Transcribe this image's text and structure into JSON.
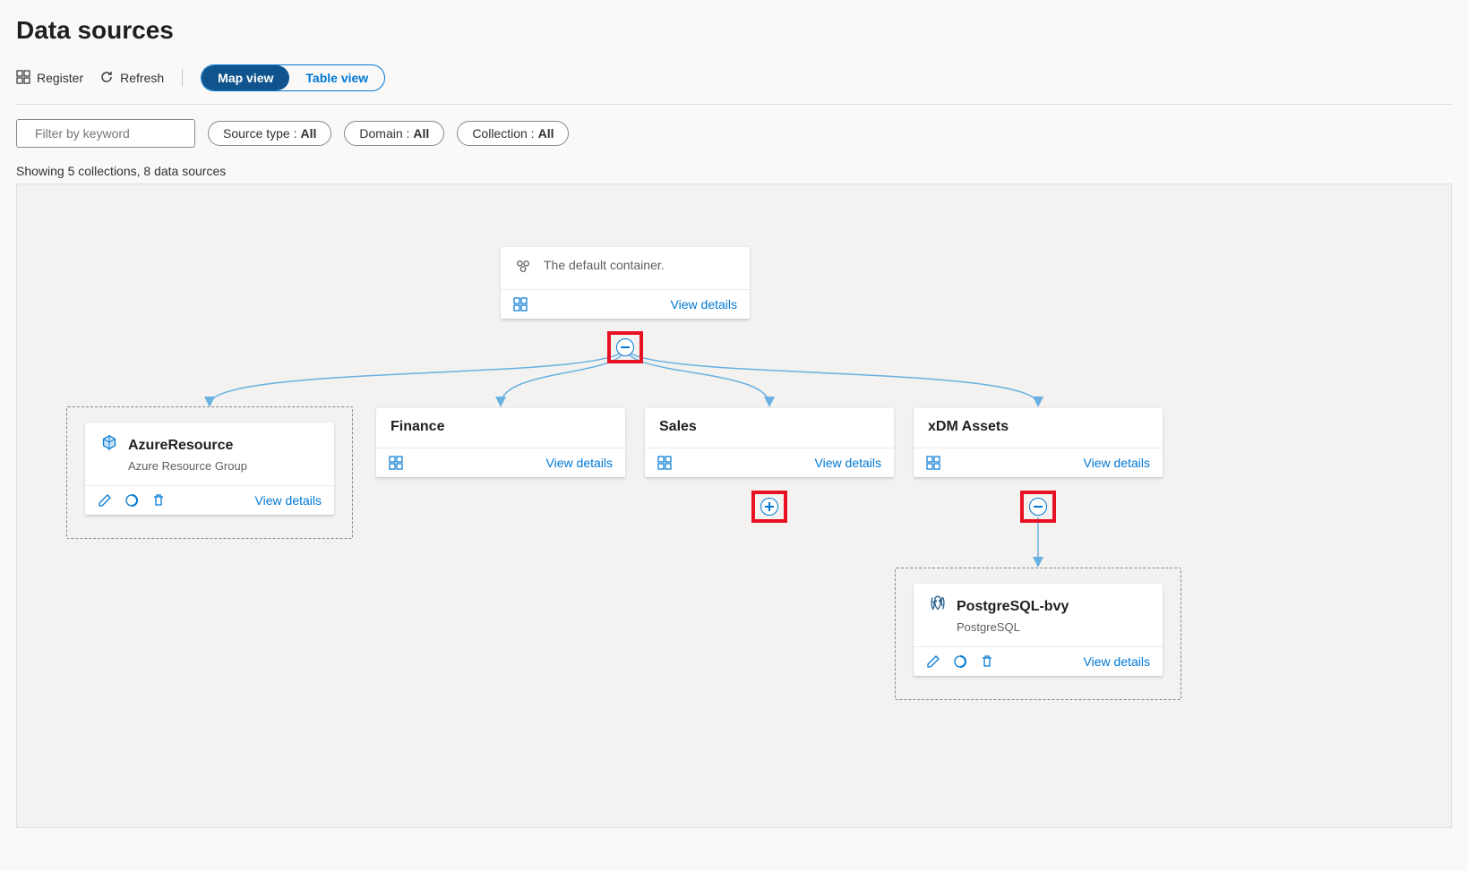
{
  "page": {
    "title": "Data sources"
  },
  "toolbar": {
    "register": "Register",
    "refresh": "Refresh",
    "view_map": "Map view",
    "view_table": "Table view"
  },
  "filters": {
    "placeholder": "Filter by keyword",
    "source_type_label": "Source type :",
    "source_type_value": "All",
    "domain_label": "Domain :",
    "domain_value": "All",
    "collection_label": "Collection :",
    "collection_value": "All"
  },
  "status": "Showing 5 collections, 8 data sources",
  "view_details": "View details",
  "nodes": {
    "root": {
      "description": "The default container."
    },
    "azure_resource": {
      "title": "AzureResource",
      "subtitle": "Azure Resource Group"
    },
    "finance": {
      "title": "Finance"
    },
    "sales": {
      "title": "Sales"
    },
    "xdm": {
      "title": "xDM Assets"
    },
    "postgres": {
      "title": "PostgreSQL-bvy",
      "subtitle": "PostgreSQL"
    }
  }
}
